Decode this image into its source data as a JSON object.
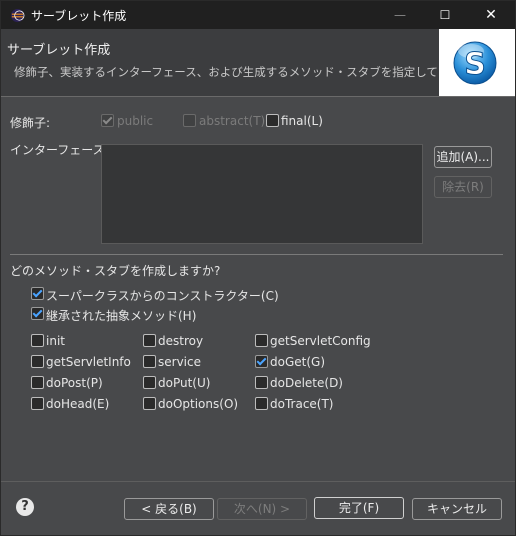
{
  "window": {
    "title": "サーブレット作成",
    "controls": {
      "minimize": "—",
      "maximize": "☐",
      "close": "✕"
    }
  },
  "banner": {
    "title": "サーブレット作成",
    "description": "修飾子、実装するインターフェース、および生成するメソッド・スタブを指定してください。"
  },
  "modifiers": {
    "label": "修飾子:",
    "public": {
      "label": "public",
      "checked": true,
      "enabled": false
    },
    "abstract": {
      "label": "abstract(T)",
      "checked": false,
      "enabled": false
    },
    "final": {
      "label": "final(L)",
      "checked": false,
      "enabled": true
    }
  },
  "interfaces": {
    "label": "インターフェース(I):",
    "add_button": "追加(A)...",
    "remove_button": "除去(R)"
  },
  "stubs": {
    "question": "どのメソッド・スタブを作成しますか?",
    "superclass_constructors": {
      "label": "スーパークラスからのコンストラクター(C)",
      "checked": true
    },
    "inherited_abstract": {
      "label": "継承された抽象メソッド(H)",
      "checked": true
    },
    "methods": [
      {
        "label": "init",
        "checked": false
      },
      {
        "label": "destroy",
        "checked": false
      },
      {
        "label": "getServletConfig",
        "checked": false
      },
      {
        "label": "getServletInfo",
        "checked": false
      },
      {
        "label": "service",
        "checked": false
      },
      {
        "label": "doGet(G)",
        "checked": true
      },
      {
        "label": "doPost(P)",
        "checked": false
      },
      {
        "label": "doPut(U)",
        "checked": false
      },
      {
        "label": "doDelete(D)",
        "checked": false
      },
      {
        "label": "doHead(E)",
        "checked": false
      },
      {
        "label": "doOptions(O)",
        "checked": false
      },
      {
        "label": "doTrace(T)",
        "checked": false
      }
    ]
  },
  "footer": {
    "back": "< 戻る(B)",
    "next": "次へ(N) >",
    "finish": "完了(F)",
    "cancel": "キャンセル",
    "help": "?"
  }
}
